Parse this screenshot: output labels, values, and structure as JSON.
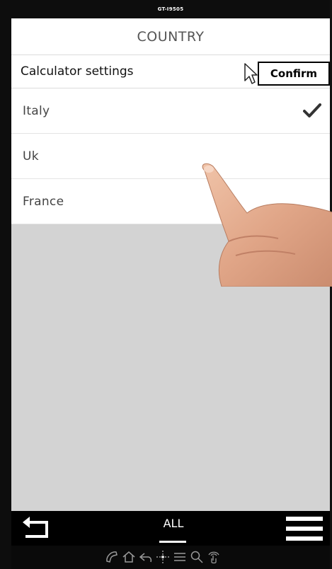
{
  "device": {
    "label": "GT-I9505"
  },
  "header": {
    "title": "COUNTRY"
  },
  "settings": {
    "label": "Calculator settings",
    "confirm_label": "Confirm"
  },
  "countries": [
    {
      "name": "Italy",
      "selected": true
    },
    {
      "name": "Uk",
      "selected": false
    },
    {
      "name": "France",
      "selected": false
    }
  ],
  "bottom_nav": {
    "tab_label": "ALL",
    "back_icon": "back-arrow-icon",
    "menu_icon": "hamburger-menu-icon"
  },
  "toolbar_icons": [
    "phone-icon",
    "home-icon",
    "reply-icon",
    "move-icon",
    "list-icon",
    "search-icon",
    "hand-pointer-icon"
  ],
  "colors": {
    "background": "#d3d3d3",
    "bar": "#000000",
    "text": "#444444"
  }
}
